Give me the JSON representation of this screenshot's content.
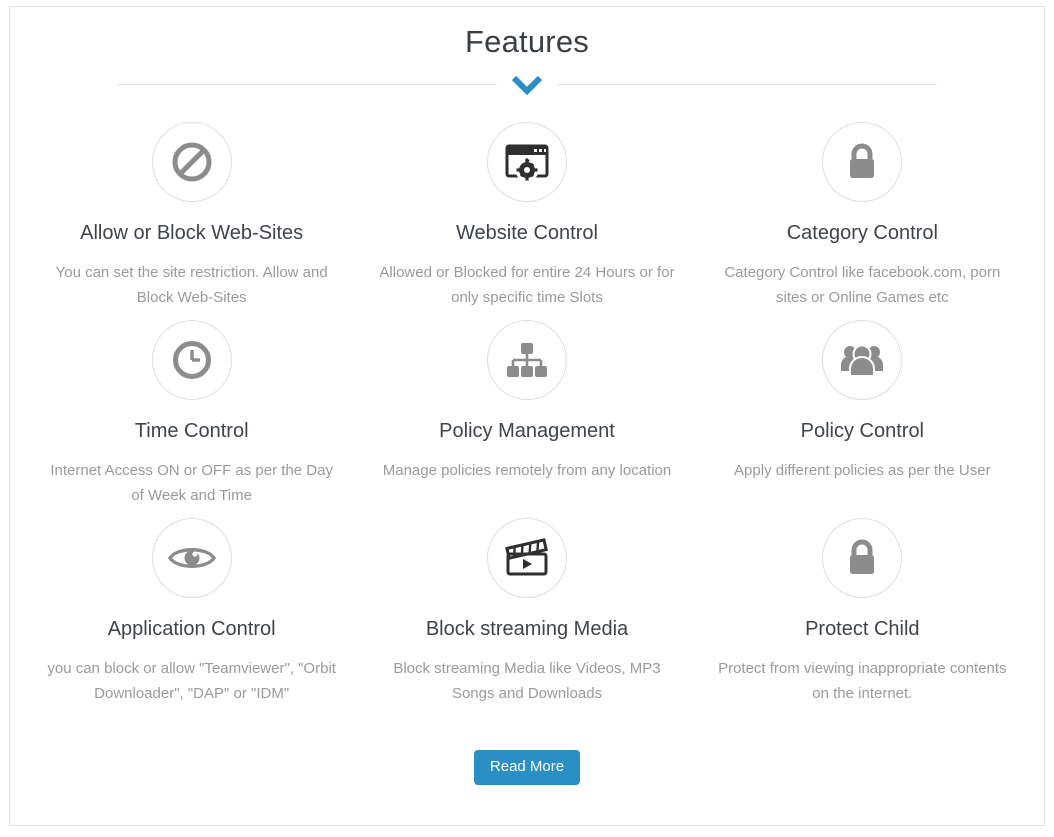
{
  "section": {
    "title": "Features",
    "chevron_icon": "chevron-down-icon",
    "chevron_color": "#2a8fc4"
  },
  "features": [
    {
      "icon": "ban-icon",
      "title": "Allow or Block Web-Sites",
      "description": "You can set the site restriction. Allow and Block Web-Sites"
    },
    {
      "icon": "browser-window-gear-icon",
      "title": "Website Control",
      "description": "Allowed or Blocked for entire 24 Hours or for only specific time Slots"
    },
    {
      "icon": "padlock-icon",
      "title": "Category Control",
      "description": "Category Control like facebook.com, porn sites or Online Games etc"
    },
    {
      "icon": "clock-icon",
      "title": "Time Control",
      "description": "Internet Access ON or OFF as per the Day of Week and Time"
    },
    {
      "icon": "sitemap-icon",
      "title": "Policy Management",
      "description": "Manage policies remotely from any location"
    },
    {
      "icon": "users-group-icon",
      "title": "Policy Control",
      "description": "Apply different policies as per the User"
    },
    {
      "icon": "eye-icon",
      "title": "Application Control",
      "description": "you can block or allow \"Teamviewer\", \"Orbit Downloader\", \"DAP\" or \"IDM\""
    },
    {
      "icon": "film-clapperboard-icon",
      "title": "Block streaming Media",
      "description": "Block streaming Media like Videos, MP3 Songs and Downloads"
    },
    {
      "icon": "padlock-icon",
      "title": "Protect Child",
      "description": "Protect from viewing inappropriate contents on the internet."
    }
  ],
  "footer": {
    "read_more_label": "Read More",
    "button_color": "#2a8fc4"
  },
  "colors": {
    "icon_gray": "#8c8c8c",
    "icon_dark": "#333333",
    "title_text": "#3f444a",
    "body_text": "#9a9a9a",
    "border": "#e0e0e0"
  }
}
